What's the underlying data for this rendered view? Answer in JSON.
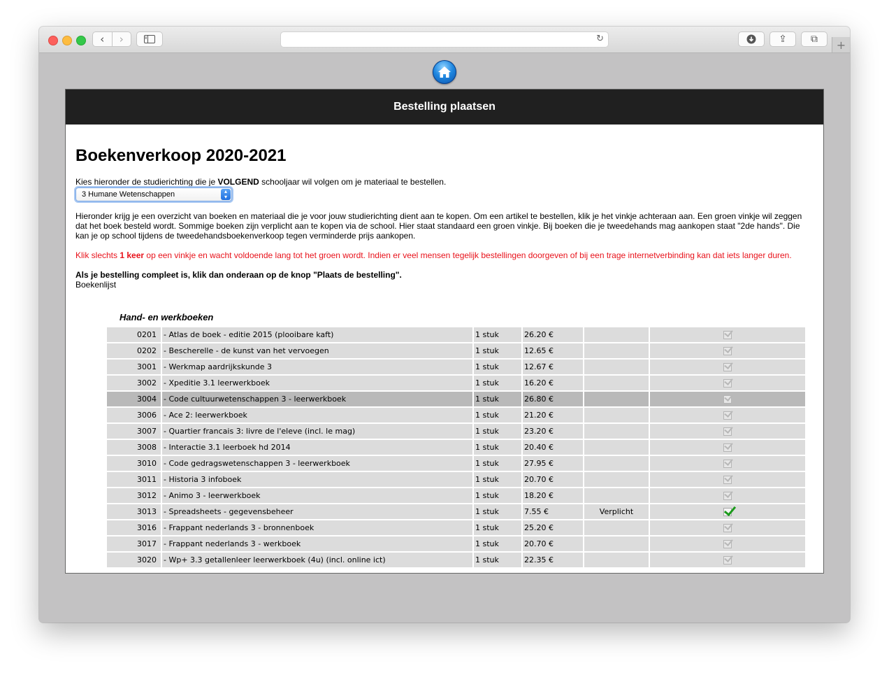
{
  "browser": {
    "controls": {
      "back_glyph": "‹",
      "forward_glyph": "›",
      "reload_glyph": "↻",
      "download_glyph": "↓",
      "share_glyph": "⇪",
      "tabs_glyph": "⧉",
      "new_tab_glyph": "+"
    }
  },
  "page": {
    "banner": "Bestelling plaatsen",
    "heading": "Boekenverkoop 2020-2021",
    "choose_before": "Kies hieronder de studierichting die je ",
    "choose_bold": "VOLGEND",
    "choose_after": " schooljaar wil volgen om je materiaal te bestellen.",
    "selected_direction": "3 Humane Wetenschappen",
    "intro": "Hieronder krijg je een overzicht van boeken en materiaal die je voor jouw studierichting dient aan te kopen. Om een artikel te bestellen, klik je het vinkje achteraan aan. Een groen vinkje wil zeggen dat het boek besteld wordt. Sommige boeken zijn verplicht aan te kopen via de school. Hier staat standaard een groen vinkje. Bij boeken die je tweedehands mag aankopen staat \"2de hands\". Die kan je op school tijdens de tweedehandsboekenverkoop tegen verminderde prijs aankopen.",
    "warn_before": "Klik slechts ",
    "warn_bold": "1 keer",
    "warn_after": " op een vinkje en wacht voldoende lang tot het groen wordt. Indien er veel mensen tegelijk bestellingen doorgeven of bij een trage internetverbinding kan dat iets langer duren.",
    "complete_note": "Als je bestelling compleet is, klik dan onderaan op de knop \"Plaats de bestelling\".",
    "list_label": "Boekenlijst",
    "section_title": "Hand- en werkboeken"
  },
  "books": [
    {
      "code": "0201",
      "title": "- Atlas de boek - editie 2015 (plooibare kaft)",
      "qty": "1 stuk",
      "price": "26.20 €",
      "status": "",
      "checked": false
    },
    {
      "code": "0202",
      "title": "- Bescherelle - de kunst van het vervoegen",
      "qty": "1 stuk",
      "price": "12.65 €",
      "status": "",
      "checked": false
    },
    {
      "code": "3001",
      "title": "- Werkmap aardrijkskunde 3",
      "qty": "1 stuk",
      "price": "12.67 €",
      "status": "",
      "checked": false
    },
    {
      "code": "3002",
      "title": "- Xpeditie 3.1 leerwerkboek",
      "qty": "1 stuk",
      "price": "16.20 €",
      "status": "",
      "checked": false
    },
    {
      "code": "3004",
      "title": "- Code cultuurwetenschappen 3 - leerwerkboek",
      "qty": "1 stuk",
      "price": "26.80 €",
      "status": "",
      "checked": false,
      "highlight": true
    },
    {
      "code": "3006",
      "title": "- Ace 2: leerwerkboek",
      "qty": "1 stuk",
      "price": "21.20 €",
      "status": "",
      "checked": false
    },
    {
      "code": "3007",
      "title": "- Quartier francais 3: livre de l'eleve (incl. le mag)",
      "qty": "1 stuk",
      "price": "23.20 €",
      "status": "",
      "checked": false
    },
    {
      "code": "3008",
      "title": "- Interactie 3.1 leerboek hd 2014",
      "qty": "1 stuk",
      "price": "20.40 €",
      "status": "",
      "checked": false
    },
    {
      "code": "3010",
      "title": "- Code gedragswetenschappen 3 - leerwerkboek",
      "qty": "1 stuk",
      "price": "27.95 €",
      "status": "",
      "checked": false
    },
    {
      "code": "3011",
      "title": "- Historia 3 infoboek",
      "qty": "1 stuk",
      "price": "20.70 €",
      "status": "",
      "checked": false
    },
    {
      "code": "3012",
      "title": "- Animo 3 - leerwerkboek",
      "qty": "1 stuk",
      "price": "18.20 €",
      "status": "",
      "checked": false
    },
    {
      "code": "3013",
      "title": "- Spreadsheets - gegevensbeheer",
      "qty": "1 stuk",
      "price": "7.55 €",
      "status": "Verplicht",
      "checked": true
    },
    {
      "code": "3016",
      "title": "- Frappant nederlands 3 - bronnenboek",
      "qty": "1 stuk",
      "price": "25.20 €",
      "status": "",
      "checked": false
    },
    {
      "code": "3017",
      "title": "- Frappant nederlands 3 - werkboek",
      "qty": "1 stuk",
      "price": "20.70 €",
      "status": "",
      "checked": false
    },
    {
      "code": "3020",
      "title": "- Wp+ 3.3 getallenleer leerwerkboek (4u) (incl. online ict)",
      "qty": "1 stuk",
      "price": "22.35 €",
      "status": "",
      "checked": false
    }
  ],
  "colors": {
    "banner_bg": "#202020",
    "warning_text": "#e8121b",
    "row_bg": "#dcdcdc",
    "row_highlight_bg": "#b9b9b9",
    "check_green": "#1b9a1b"
  }
}
